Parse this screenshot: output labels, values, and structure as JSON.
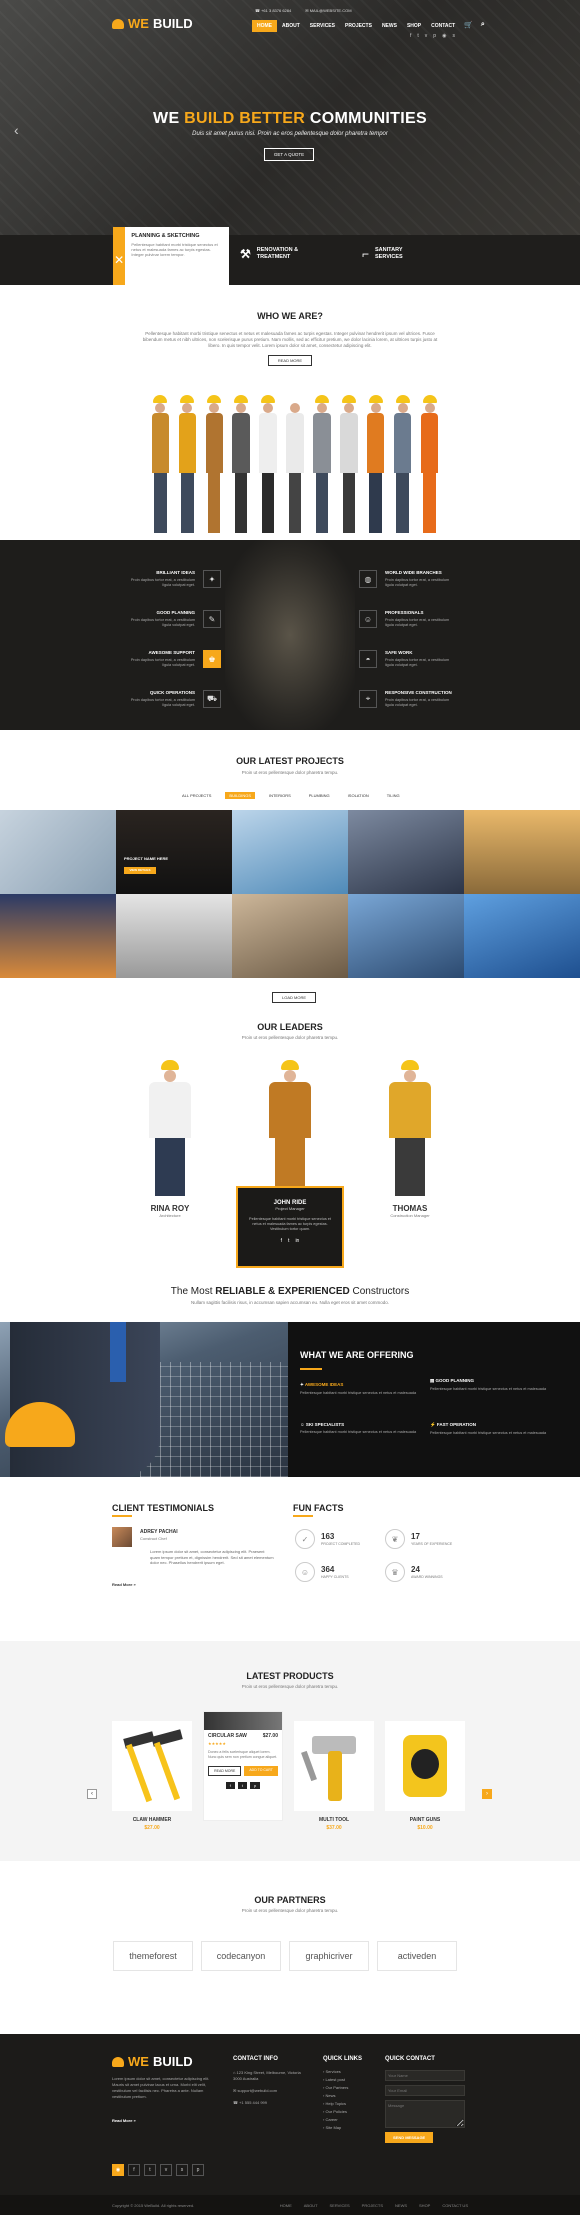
{
  "brand": {
    "name_a": "WE",
    "name_b": "BUILD",
    "phone": "+61 3 8376 6284",
    "email": "MAIL@WEBSITE.COM"
  },
  "nav": [
    "HOME",
    "ABOUT",
    "SERVICES",
    "PROJECTS",
    "NEWS",
    "SHOP",
    "CONTACT"
  ],
  "hero": {
    "title_a": "WE ",
    "title_b": "BUILD BETTER",
    "title_c": " COMMUNITIES",
    "subtitle": "Duis sit amet purus nisi. Proin ac eros pellentesque dolor pharetra tempor",
    "button": "GET A QUOTE"
  },
  "services": [
    {
      "title": "PLANNING & SKETCHING",
      "text": "Pellentesque habitant morbi tristique senectus et netus et malesuada fames ac turpis egestas. Integer pulvinar lorem tempor."
    },
    {
      "title": "RENOVATION & TREATMENT"
    },
    {
      "title": "SANITARY SERVICES"
    }
  ],
  "who": {
    "title": "WHO WE ARE?",
    "text": "Pellentesque habitant morbi tristique senectus et netus et malesuada fames ac turpis egestas. Integer pulvinar hendrerit ipsum vel ultrices. Fusce bibendum metus et nibh ultrices, non scelerisque purus pretium. Nam mollis, sed ac efficitur pretium, we dolor lacinia lorem, at ultrices turpis justo at libero. In quis tempor velit. Lorem ipsum dolor sit amet, consectetur adipiscing elit.",
    "button": "READ MORE"
  },
  "features": [
    {
      "title": "BRILLIANT IDEAS",
      "text": "Proin dapibus tortor erat, a vestibulum ligula volutpat eget."
    },
    {
      "title": "GOOD PLANNING",
      "text": "Proin dapibus tortor erat, a vestibulum ligula volutpat eget."
    },
    {
      "title": "AWESOME SUPPORT",
      "text": "Proin dapibus tortor erat, a vestibulum ligula volutpat eget."
    },
    {
      "title": "QUICK OPERATIONS",
      "text": "Proin dapibus tortor erat, a vestibulum ligula volutpat eget."
    },
    {
      "title": "WORLD WIDE BRANCHES",
      "text": "Proin dapibus tortor erat, a vestibulum ligula volutpat eget."
    },
    {
      "title": "PROFESSIONALS",
      "text": "Proin dapibus tortor erat, a vestibulum ligula volutpat eget."
    },
    {
      "title": "SAFE WORK",
      "text": "Proin dapibus tortor erat, a vestibulum ligula volutpat eget."
    },
    {
      "title": "RESPONSIVE CONSTRUCTION",
      "text": "Proin dapibus tortor erat, a vestibulum ligula volutpat eget."
    }
  ],
  "projects": {
    "title": "OUR LATEST PROJECTS",
    "lead": "Proin ut eros pellentesque dolor pharetra tempu.",
    "filters": [
      "ALL PROJECTS",
      "BUILDINGS",
      "INTERIORS",
      "PLUMBING",
      "ISOLATION",
      "TILING"
    ],
    "caption": "PROJECT NAME HERE",
    "caption_btn": "VIEW DETAILS",
    "load": "LOAD MORE"
  },
  "leaders": {
    "title": "OUR LEADERS",
    "lead": "Proin ut eros pellentesque dolor pharetra tempu.",
    "people": [
      {
        "name": "RINA ROY",
        "role": "Architecture"
      },
      {
        "name": "JOHN RIDE",
        "role": "Project Manager",
        "text": "Pellentesque habitant morbi tristique senectus et netus et malesuada fames ac turpis egestas. Vestibulum tortor quam."
      },
      {
        "name": "THOMAS",
        "role": "Construction Manager"
      }
    ]
  },
  "reliable": {
    "a": "The Most ",
    "b": "RELIABLE & EXPERIENCED",
    "c": " Constructors",
    "text": "Nullam sagittis facilisis risus, in accumsan sapien accumsan eu. Nulla eget eros sit amet commodo."
  },
  "offer": {
    "title": "WHAT WE ARE OFFERING",
    "items": [
      {
        "title": "AWESOME IDEAS",
        "text": "Pellentesque habitant morbi tristique senectus et netus et malesuada"
      },
      {
        "title": "GOOD PLANNING",
        "text": "Pellentesque habitant morbi tristique senectus et netus et malesuada"
      },
      {
        "title": "SKI SPECIALISTS",
        "text": "Pellentesque habitant morbi tristique senectus et netus et malesuada"
      },
      {
        "title": "FAST OPERATION",
        "text": "Pellentesque habitant morbi tristique senectus et netus et malesuada"
      }
    ]
  },
  "testimonials": {
    "title": "CLIENT TESTIMONIALS",
    "name": "ADREY PACHAI",
    "role": "Construct Chef",
    "text": "Lorem ipsum dolor sit amet, consectetur adipiscing elit. Praesent quam tempor pretium et, dignissim hendrerit. Sed sit amet elementum dolor nec. Phasellus hendrerit ipsum eget.",
    "more": "Read More »"
  },
  "facts": {
    "title": "FUN FACTS",
    "items": [
      {
        "n": "163",
        "l": "PROJECT COMPLETED"
      },
      {
        "n": "17",
        "l": "YEARS OF EXPERIENCE"
      },
      {
        "n": "364",
        "l": "HAPPY CLIENTS"
      },
      {
        "n": "24",
        "l": "AWARD WINNINGS"
      }
    ]
  },
  "products": {
    "title": "LATEST PRODUCTS",
    "lead": "Proin ut eros pellentesque dolor pharetra tempu.",
    "items": [
      {
        "name": "CLAW HAMMER",
        "price": "$27.00"
      },
      {
        "name": "CIRCULAR SAW",
        "price": "$27.00",
        "text": "Donec a felis scelerisque aliquet lorem. Nunc quis sem non pretium congue aliquet.",
        "btn1": "READ MORE",
        "btn2": "ADD TO CART"
      },
      {
        "name": "MULTI TOOL",
        "price": "$37.00"
      },
      {
        "name": "PAINT GUNS",
        "price": "$10.00"
      }
    ]
  },
  "partners": {
    "title": "OUR PARTNERS",
    "lead": "Proin ut eros pellentesque dolor pharetra tempu.",
    "logos": [
      "themeforest",
      "codecanyon",
      "graphicriver",
      "activeden"
    ]
  },
  "footer": {
    "about": "Lorem ipsum dolor sit amet, consectetur adipiscing elit. Mauris sit amet pulvinar lacus et urna. Morbi elit velit, vestibulum vel facilisis nec. Pharetra a ante. Nullam vestibulum pretium.",
    "readmore": "Read More »",
    "contact_title": "CONTACT INFO",
    "contact": [
      "123 King Street, Melbourne, Victoria 3000 Australia",
      "support@webuild.com",
      "+1 555 444 999"
    ],
    "links_title": "QUICK LINKS",
    "links": [
      "Services",
      "Latest post",
      "Our Partners",
      "News",
      "Help Topics",
      "Our Policies",
      "Career",
      "Site Map"
    ],
    "qc_title": "QUICK CONTACT",
    "name_ph": "Your Name",
    "email_ph": "Your Email",
    "msg_ph": "Message",
    "send": "SEND MESSAGE",
    "copyright": "Copyright © 2015 WeBuild. All rights reserved.",
    "bottom_nav": [
      "HOME",
      "ABOUT",
      "SERVICES",
      "PROJECTS",
      "NEWS",
      "SHOP",
      "CONTACT US"
    ]
  }
}
